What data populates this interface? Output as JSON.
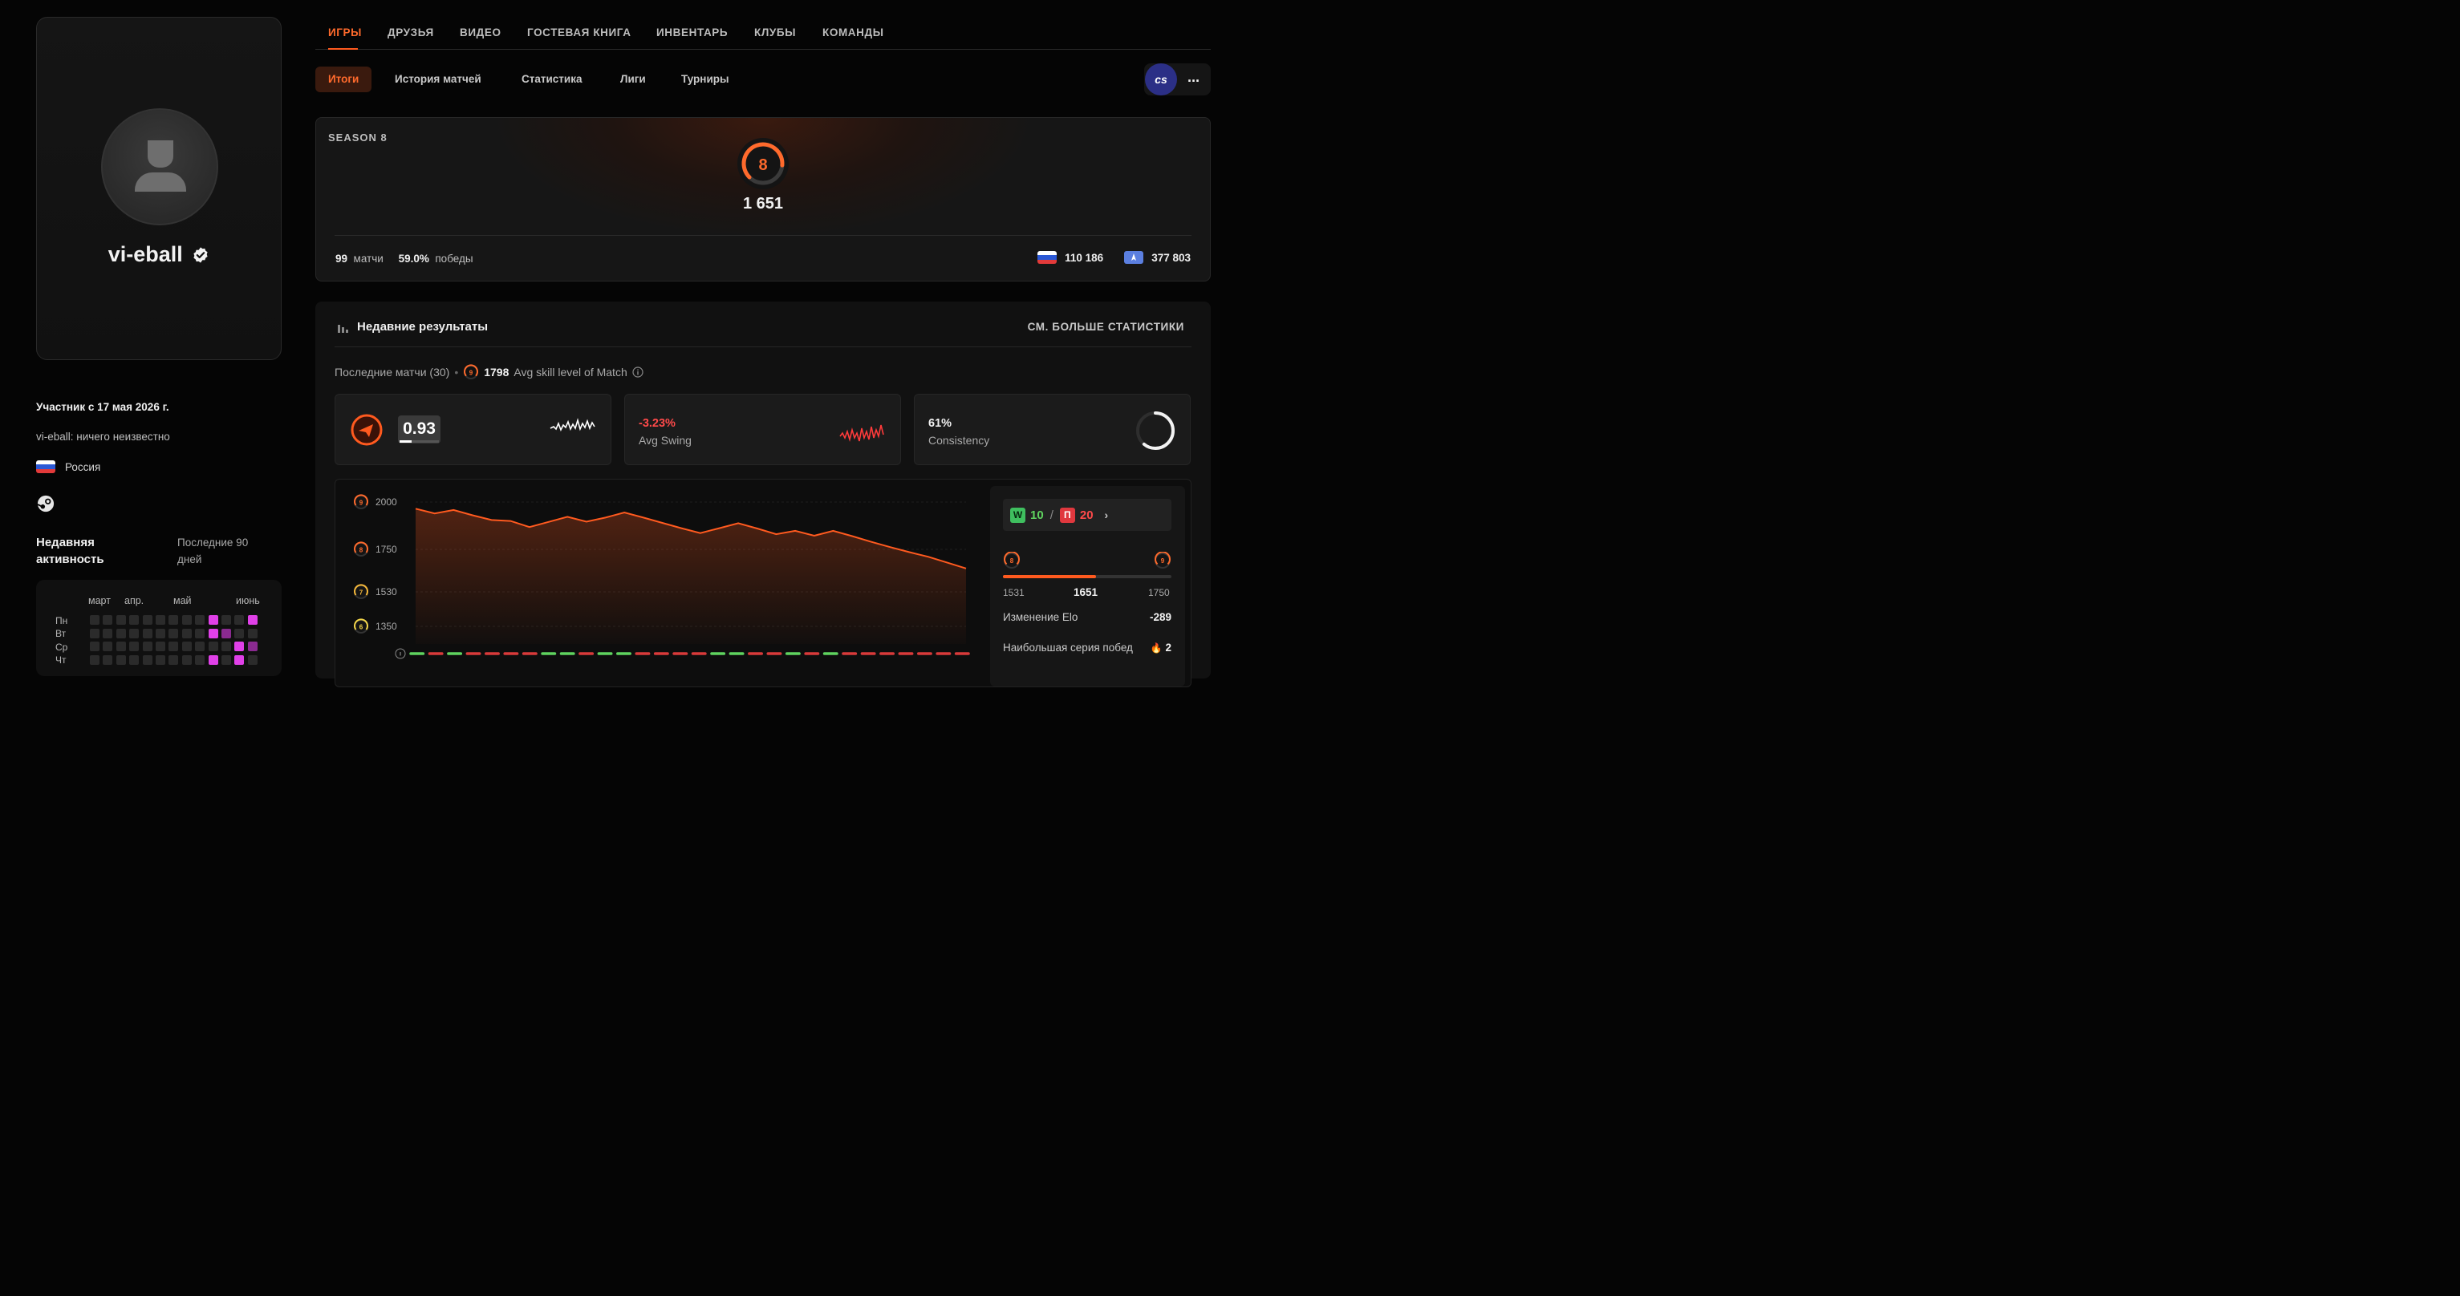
{
  "profile": {
    "username": "vi-eball",
    "member_since": "Участник с 17 мая 2026 г.",
    "bio": "vi-eball: ничего неизвестно",
    "country": "Россия",
    "activity_title": "Недавняя активность",
    "activity_period": "Последние 90 дней",
    "heatmap": {
      "months": [
        "март",
        "апр.",
        "май",
        "июнь"
      ],
      "days": [
        "Пн",
        "Вт",
        "Ср",
        "Чт"
      ],
      "active_color": "#e040e8",
      "dim_active_color": "#8a2a90"
    }
  },
  "nav": {
    "tabs": [
      "ИГРЫ",
      "ДРУЗЬЯ",
      "ВИДЕО",
      "ГОСТЕВАЯ КНИГА",
      "ИНВЕНТАРЬ",
      "КЛУБЫ",
      "КОМАНДЫ"
    ],
    "active_tab": "ИГРЫ",
    "subtabs": [
      "Итоги",
      "История матчей",
      "Статистика",
      "Лиги",
      "Турниры"
    ],
    "active_subtab": "Итоги",
    "game_badge": "cs",
    "more": "···"
  },
  "season": {
    "label": "SEASON 8",
    "level": "8",
    "elo": "1 651",
    "matches_value": "99",
    "matches_label": "матчи",
    "winrate_value": "59.0%",
    "winrate_label": "победы",
    "country_rank": "110 186",
    "region_rank": "377 803"
  },
  "results": {
    "title": "Недавние результаты",
    "see_more": "СМ. БОЛЬШЕ СТАТИСТИКИ",
    "last_matches": "Последние матчи (30)",
    "avg_level_badge": "9",
    "avg_skill_value": "1798",
    "avg_skill_label": "Avg skill level of Match",
    "rating": "0.93",
    "rating_fill": 0.3,
    "swing_value": "-3.23%",
    "swing_label": "Avg Swing",
    "consistency_value": "61%",
    "consistency_label": "Consistency",
    "consistency_fraction": 0.61
  },
  "chart_data": {
    "type": "area",
    "y_ticks": [
      {
        "value": 2000,
        "label": "2000",
        "level": "9"
      },
      {
        "value": 1750,
        "label": "1750",
        "level": "8"
      },
      {
        "value": 1530,
        "label": "1530",
        "level": "7"
      },
      {
        "value": 1350,
        "label": "1350",
        "level": "6"
      }
    ],
    "x": [
      1,
      2,
      3,
      4,
      5,
      6,
      7,
      8,
      9,
      10,
      11,
      12,
      13,
      14,
      15,
      16,
      17,
      18,
      19,
      20,
      21,
      22,
      23,
      24,
      25,
      26,
      27,
      28,
      29,
      30
    ],
    "values": [
      1965,
      1940,
      1958,
      1930,
      1905,
      1900,
      1868,
      1895,
      1922,
      1896,
      1918,
      1945,
      1918,
      1890,
      1862,
      1836,
      1862,
      1888,
      1860,
      1830,
      1848,
      1822,
      1848,
      1820,
      1790,
      1762,
      1736,
      1712,
      1682,
      1651
    ],
    "results": [
      "W",
      "L",
      "W",
      "L",
      "L",
      "L",
      "L",
      "W",
      "W",
      "L",
      "W",
      "W",
      "L",
      "L",
      "L",
      "L",
      "W",
      "W",
      "L",
      "L",
      "W",
      "L",
      "W",
      "L",
      "L",
      "L",
      "L",
      "L",
      "L",
      "L"
    ],
    "colors": {
      "line": "#ff5a1f",
      "win": "#5fd35f",
      "loss": "#d83a3a"
    }
  },
  "side": {
    "wins_tag": "W",
    "wins": "10",
    "slash": "/",
    "losses_tag": "П",
    "losses": "20",
    "level_left": "8",
    "level_right": "9",
    "range_min": "1531",
    "current": "1651",
    "range_max": "1750",
    "progress": 0.55,
    "elo_change_label": "Изменение Elo",
    "elo_change_value": "-289",
    "streak_label": "Наибольшая серия побед",
    "streak_value": "2"
  }
}
